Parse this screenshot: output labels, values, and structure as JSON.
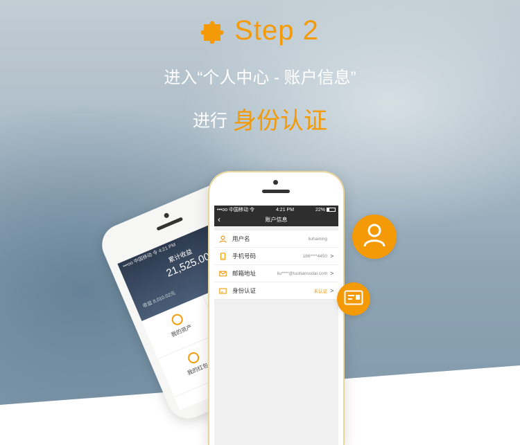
{
  "heading": {
    "step": "Step 2",
    "line1": "进入“个人中心 - 账户信息”",
    "line2_prefix": "进行",
    "line2_highlight": "身份认证"
  },
  "colors": {
    "accent": "#f39a06",
    "dark_bar": "#2e2e2e"
  },
  "back_phone": {
    "status": "•••oo 中国移动 令    4:21 PM",
    "label": "累计收益",
    "amount": "21,525.00元",
    "sub": "收益 8,010.02元",
    "cells": [
      "我的资产",
      "",
      "我的红包",
      ""
    ]
  },
  "front_phone": {
    "status": {
      "carrier": "•••oo 中国移动 令",
      "time": "4:21 PM",
      "battery": "22%"
    },
    "nav_title": "账户信息",
    "rows": [
      {
        "icon": "user-icon",
        "label": "用户名",
        "value": "liuhaining",
        "arrow": ""
      },
      {
        "icon": "phone-icon",
        "label": "手机号码",
        "value": "186****4450",
        "arrow": ">"
      },
      {
        "icon": "mail-icon",
        "label": "邮箱地址",
        "value": "liu****@tuotiansudai.com",
        "arrow": ">"
      },
      {
        "icon": "id-card-icon",
        "label": "身份认证",
        "value": "未认证",
        "arrow": ">"
      }
    ]
  },
  "badges": {
    "user": "user-icon",
    "card": "id-card-icon"
  }
}
